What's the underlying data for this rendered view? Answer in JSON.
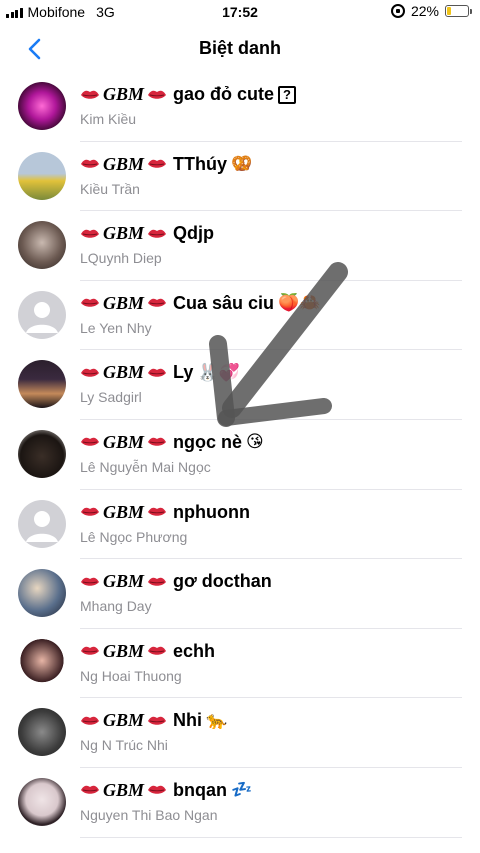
{
  "status_bar": {
    "carrier": "Mobifone",
    "network": "3G",
    "time": "17:52",
    "battery_percent": "22%"
  },
  "nav": {
    "title": "Biệt danh"
  },
  "tag_text": "GBM",
  "rows": [
    {
      "nickname": "gao đỏ cute",
      "name": "Kim Kiều",
      "extra": "?"
    },
    {
      "nickname": "TThúy",
      "name": "Kiều Trần",
      "extra": "🥨"
    },
    {
      "nickname": "Qdjp",
      "name": "LQuynh Diep",
      "extra": ""
    },
    {
      "nickname": "Cua sâu ciu",
      "name": "Le Yen Nhy",
      "extra": "🍑🦀"
    },
    {
      "nickname": "Ly",
      "name": "Ly Sadgirl",
      "extra": "🐰💞"
    },
    {
      "nickname": "ngọc nè",
      "name": "Lê Nguyễn Mai Ngọc",
      "extra": "😘"
    },
    {
      "nickname": "nphuonn",
      "name": "Lê Ngọc Phương",
      "extra": ""
    },
    {
      "nickname": "gơ docthan",
      "name": "Mhang Day",
      "extra": ""
    },
    {
      "nickname": "echh",
      "name": "Ng Hoai Thuong",
      "extra": ""
    },
    {
      "nickname": "Nhi",
      "name": "Ng N Trúc Nhi",
      "extra": "🐆"
    },
    {
      "nickname": "bnqan",
      "name": "Nguyen Thi Bao Ngan",
      "extra": "💤"
    }
  ],
  "colors": {
    "accent": "#1a7cf5",
    "subtext": "#8e8e93",
    "divider": "#e5e5ea",
    "lips": "#d7263d"
  }
}
